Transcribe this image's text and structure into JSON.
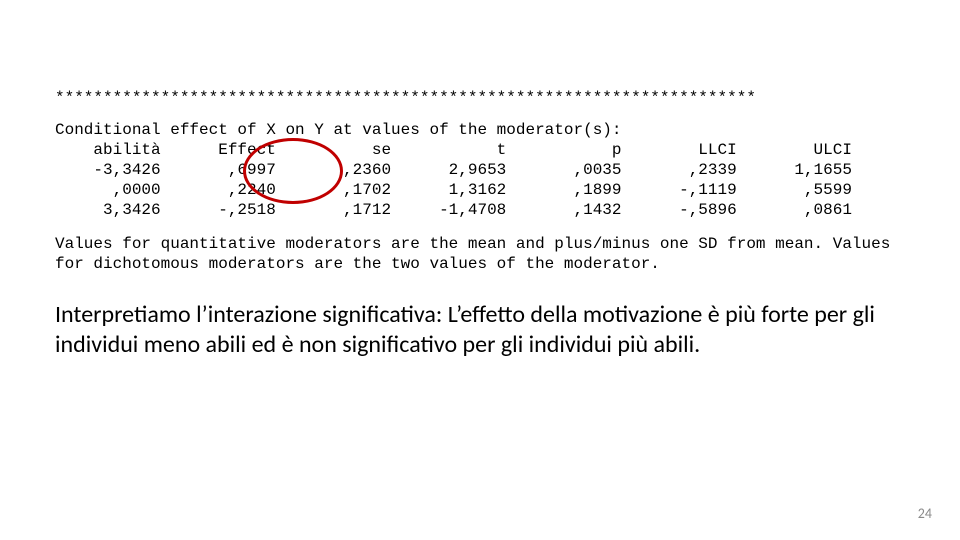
{
  "stars": "*************************************************************************",
  "table": {
    "title": "Conditional effect of X on Y at values of the moderator(s):",
    "headers": {
      "c1": "abilità",
      "c2": "Effect",
      "c3": "se",
      "c4": "t",
      "c5": "p",
      "c6": "LLCI",
      "c7": "ULCI"
    },
    "rows": [
      {
        "c1": "-3,3426",
        "c2": ",6997",
        "c3": ",2360",
        "c4": "2,9653",
        "c5": ",0035",
        "c6": ",2339",
        "c7": "1,1655"
      },
      {
        "c1": ",0000",
        "c2": ",2240",
        "c3": ",1702",
        "c4": "1,3162",
        "c5": ",1899",
        "c6": "-,1119",
        "c7": ",5599"
      },
      {
        "c1": "3,3426",
        "c2": "-,2518",
        "c3": ",1712",
        "c4": "-1,4708",
        "c5": ",1432",
        "c6": "-,5896",
        "c7": ",0861"
      }
    ]
  },
  "footnote": "Values for quantitative moderators are the mean and plus/minus one SD from mean.\nValues for dichotomous moderators are the two values of the moderator.",
  "interpretation": "Interpretiamo l’interazione significativa: L’effetto della motivazione è più forte per gli individui meno abili ed è non significativo per gli individui più abili.",
  "pagenum": "24"
}
